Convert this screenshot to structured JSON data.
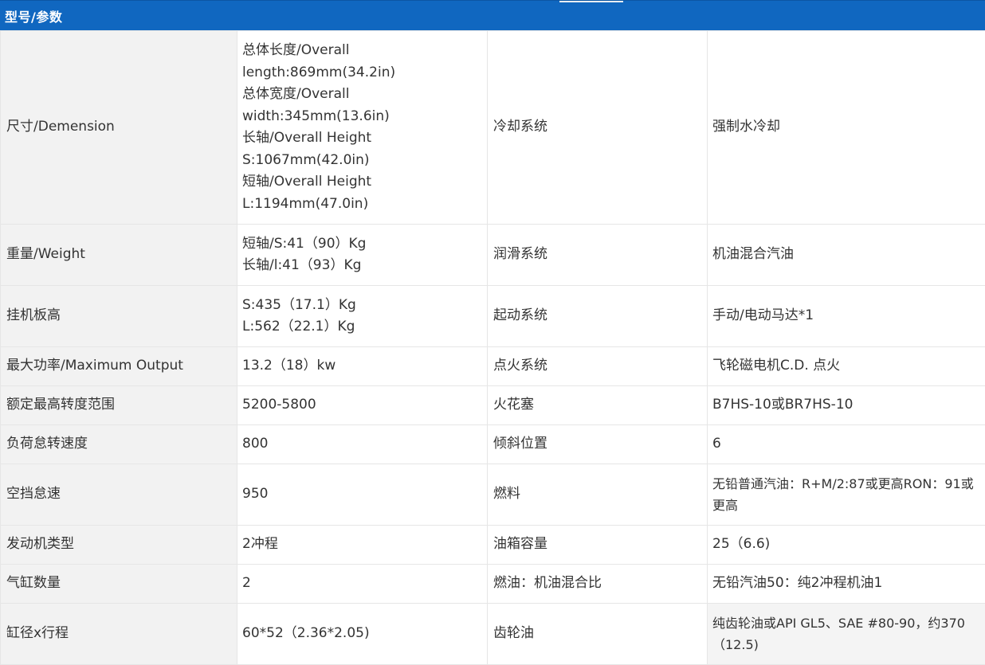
{
  "header": {
    "title": "型号/参数"
  },
  "rows": [
    {
      "label": "尺寸/Demension",
      "values": [
        "总体长度/Overall",
        "length:869mm(34.2in)",
        "总体宽度/Overall",
        "width:345mm(13.6in)",
        "长轴/Overall Height",
        "S:1067mm(42.0in)",
        "短轴/Overall Height",
        "L:1194mm(47.0in)"
      ],
      "label2": "冷却系统",
      "value2": "强制水冷却"
    },
    {
      "label": "重量/Weight",
      "values": [
        "短轴/S:41（90）Kg",
        "长轴/l:41（93）Kg"
      ],
      "label2": "润滑系统",
      "value2": "机油混合汽油"
    },
    {
      "label": "挂机板高",
      "values": [
        "S:435（17.1）Kg",
        "L:562（22.1）Kg"
      ],
      "label2": "起动系统",
      "value2": "手动/电动马达*1"
    },
    {
      "label": "最大功率/Maximum Output",
      "values": [
        "13.2（18）kw"
      ],
      "label2": "点火系统",
      "value2": "飞轮磁电机C.D. 点火"
    },
    {
      "label": "额定最高转度范围",
      "values": [
        "5200-5800"
      ],
      "label2": "火花塞",
      "value2": "B7HS-10或BR7HS-10"
    },
    {
      "label": "负荷怠转速度",
      "values": [
        "800"
      ],
      "label2": "倾斜位置",
      "value2": "6"
    },
    {
      "label": "空挡怠速",
      "values": [
        "950"
      ],
      "label2": "燃料",
      "value2": "无铅普通汽油：R+M/2:87或更高RON：91或更高"
    },
    {
      "label": "发动机类型",
      "values": [
        "2冲程"
      ],
      "label2": "油箱容量",
      "value2": "25（6.6)"
    },
    {
      "label": "气缸数量",
      "values": [
        "2"
      ],
      "label2": "燃油：机油混合比",
      "value2": "无铅汽油50：纯2冲程机油1"
    },
    {
      "label": "缸径x行程",
      "values": [
        "60*52（2.36*2.05)"
      ],
      "label2": "齿轮油",
      "value2": "纯齿轮油或API GL5、SAE #80-90，约370（12.5)"
    }
  ]
}
